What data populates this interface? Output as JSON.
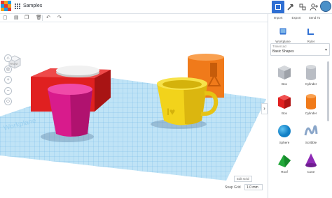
{
  "header": {
    "title": "Samples",
    "buttons": {
      "import": "Import",
      "export": "Export",
      "send_to": "Send To"
    }
  },
  "panel": {
    "tools": {
      "workplane": "Workplane",
      "ruler": "Ruler"
    },
    "library_heading": "Tinkercad",
    "library_name": "Basic Shapes",
    "shapes": [
      {
        "label": "Box"
      },
      {
        "label": "Cylinder"
      },
      {
        "label": "Box"
      },
      {
        "label": "Cylinder"
      },
      {
        "label": "Sphere"
      },
      {
        "label": "Scribble"
      },
      {
        "label": "Roof"
      },
      {
        "label": "Cone"
      }
    ]
  },
  "canvas": {
    "viewcube_face": "FRONT",
    "workplane_text": "Workplane",
    "edit_grid": "Edit Grid",
    "snap_grid_label": "Snap Grid",
    "snap_grid_value": "1.0 mm"
  },
  "colors": {
    "accent": "#2f6fd3",
    "box_red": "#e02020",
    "cone_magenta": "#d81b8c",
    "mug_yellow": "#f2d31b",
    "orange": "#f07a1a"
  }
}
